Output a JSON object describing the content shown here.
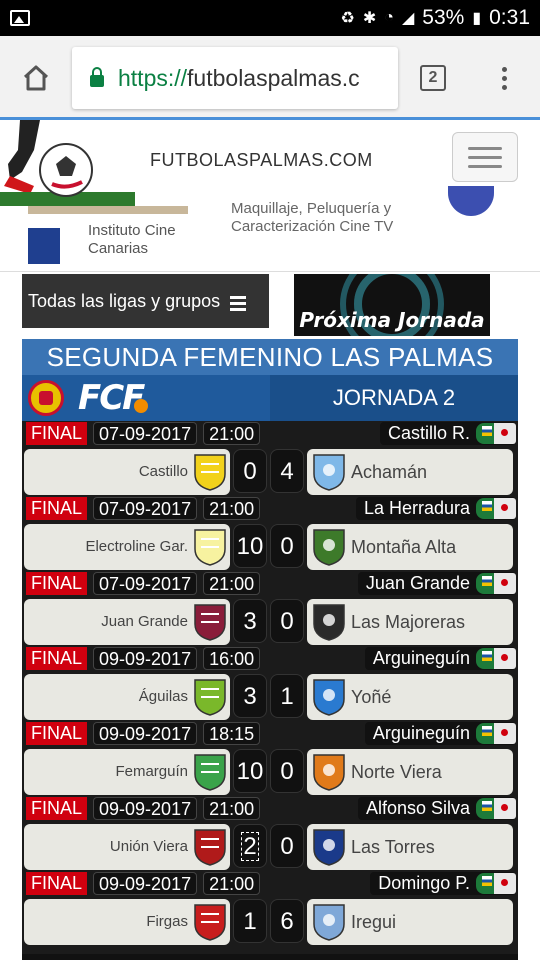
{
  "status_bar": {
    "battery": "53%",
    "time": "0:31"
  },
  "browser": {
    "url_scheme": "https://",
    "url_rest": "futbolaspalmas.c",
    "tab_count": "2"
  },
  "site": {
    "title": "FUTBOLASPALMAS.COM"
  },
  "ad": {
    "institution": "Instituto Cine Canarias",
    "text": "Maquillaje, Peluquería y Caracterización Cine TV"
  },
  "nav": {
    "all_leagues": "Todas las ligas y grupos",
    "next_round": "Próxima Jornada"
  },
  "league": {
    "title": "SEGUNDA FEMENINO LAS PALMAS",
    "federation": "FCF",
    "round": "JORNADA 2"
  },
  "matches": [
    {
      "status": "FINAL",
      "date": "07-09-2017",
      "time": "21:00",
      "venue": "Castillo R.",
      "home": "Castillo",
      "home_score": "0",
      "away_score": "4",
      "away": "Achamán",
      "home_crest": "#f2d21b",
      "away_crest": "#7fb8e8"
    },
    {
      "status": "FINAL",
      "date": "07-09-2017",
      "time": "21:00",
      "venue": "La Herradura",
      "home": "Electroline Gar.",
      "home_score": "10",
      "away_score": "0",
      "away": "Montaña Alta",
      "home_crest": "#f7f2a0",
      "away_crest": "#3d7a2a"
    },
    {
      "status": "FINAL",
      "date": "07-09-2017",
      "time": "21:00",
      "venue": "Juan Grande",
      "home": "Juan Grande",
      "home_score": "3",
      "away_score": "0",
      "away": "Las Majoreras",
      "home_crest": "#8a1d3a",
      "away_crest": "#2a2a2a"
    },
    {
      "status": "FINAL",
      "date": "09-09-2017",
      "time": "16:00",
      "venue": "Arguineguín",
      "home": "Águilas",
      "home_score": "3",
      "away_score": "1",
      "away": "Yoñé",
      "home_crest": "#7ab82a",
      "away_crest": "#2a7ad0"
    },
    {
      "status": "FINAL",
      "date": "09-09-2017",
      "time": "18:15",
      "venue": "Arguineguín",
      "home": "Femarguín",
      "home_score": "10",
      "away_score": "0",
      "away": "Norte Viera",
      "home_crest": "#3aa34a",
      "away_crest": "#e07a1a"
    },
    {
      "status": "FINAL",
      "date": "09-09-2017",
      "time": "21:00",
      "venue": "Alfonso Silva",
      "home": "Unión Viera",
      "home_score": "2",
      "away_score": "0",
      "away": "Las Torres",
      "home_crest": "#b01a1a",
      "away_crest": "#1a3a8a"
    },
    {
      "status": "FINAL",
      "date": "09-09-2017",
      "time": "21:00",
      "venue": "Domingo P.",
      "home": "Firgas",
      "home_score": "1",
      "away_score": "6",
      "away": "Iregui",
      "home_crest": "#c81d1d",
      "away_crest": "#7fa8d8"
    }
  ]
}
